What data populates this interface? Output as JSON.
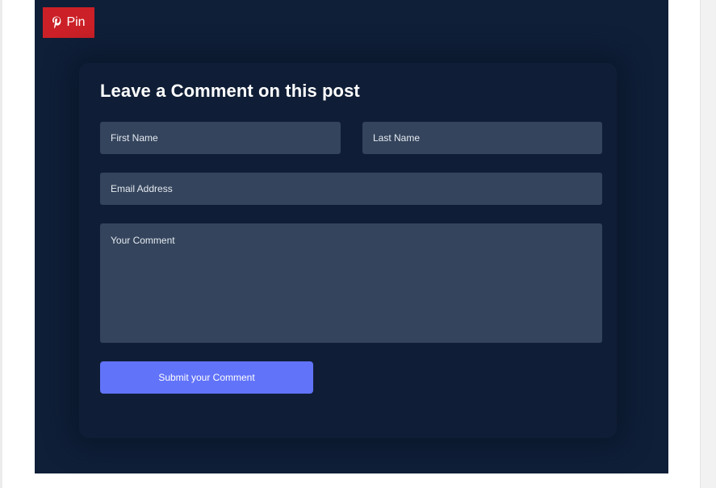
{
  "pin": {
    "label": "Pin",
    "icon": "pinterest-icon",
    "color": "#cb2027"
  },
  "comment_form": {
    "title": "Leave a Comment on this post",
    "first_name": {
      "value": "",
      "placeholder": "First Name"
    },
    "last_name": {
      "value": "",
      "placeholder": "Last Name"
    },
    "email": {
      "value": "",
      "placeholder": "Email Address"
    },
    "comment": {
      "value": "",
      "placeholder": "Your Comment"
    },
    "submit_label": "Submit your Comment"
  },
  "colors": {
    "background": "#0f1f38",
    "field": "#34445c",
    "accent": "#6173f9"
  }
}
